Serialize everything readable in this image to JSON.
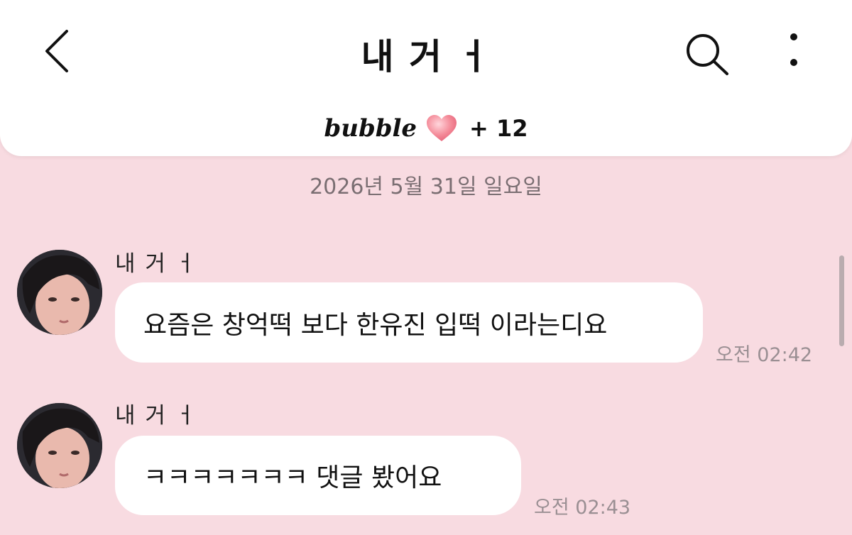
{
  "header": {
    "title": "내 거 ㅓ",
    "brand": "bubble",
    "count": "+ 12"
  },
  "date_separator": "2026년 5월 31일 일요일",
  "messages": [
    {
      "sender": "내 거 ㅓ",
      "text": "요즘은 창억떡 보다 한유진 입떡 이라는디요",
      "time": "오전 02:42"
    },
    {
      "sender": "내 거 ㅓ",
      "text": "ㅋㅋㅋㅋㅋㅋㅋ 댓글 봤어요",
      "time": "오전 02:43"
    }
  ],
  "icons": [
    "back-chevron-icon",
    "search-icon",
    "more-vertical-icon",
    "heart-icon"
  ],
  "colors": {
    "background": "#f8dbe1",
    "header": "#ffffff",
    "bubble": "#ffffff"
  }
}
